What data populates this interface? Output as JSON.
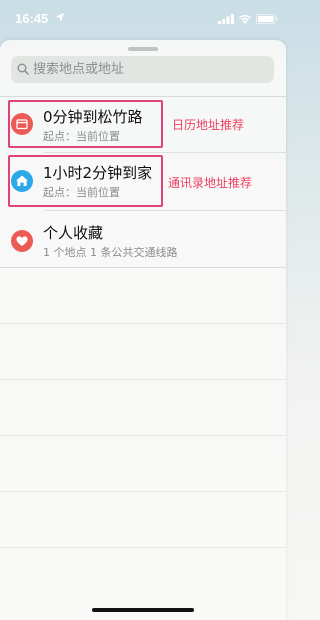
{
  "status_bar": {
    "time": "16:45"
  },
  "search": {
    "placeholder": "搜索地点或地址"
  },
  "items": [
    {
      "title": "0分钟到松竹路",
      "subtitle": "起点：当前位置",
      "icon": "calendar-icon",
      "color": "#ec5a56"
    },
    {
      "title": "1小时2分钟到家",
      "subtitle": "起点：当前位置",
      "icon": "home-icon",
      "color": "#2ba8e8"
    },
    {
      "title": "个人收藏",
      "subtitle": "1 个地点 1 条公共交通线路",
      "icon": "heart-icon",
      "color": "#ec5a56"
    }
  ],
  "annotations": [
    "日历地址推荐",
    "通讯录地址推荐"
  ],
  "colors": {
    "highlight": "#e0437c",
    "annotation": "#ee3f61"
  }
}
